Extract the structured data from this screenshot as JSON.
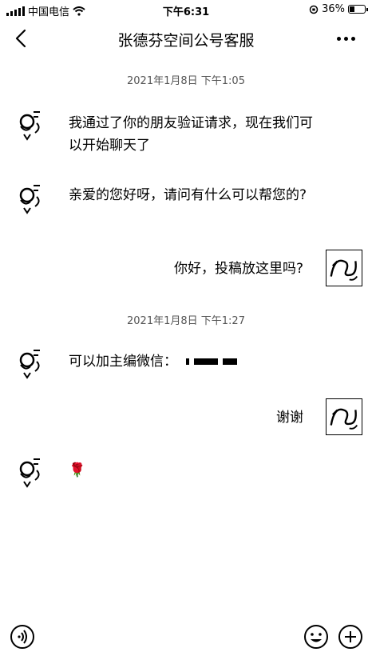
{
  "status_bar": {
    "carrier": "中国电信",
    "time": "下午6:31",
    "battery": "36%",
    "battery_level": 0.36
  },
  "header": {
    "title": "张德芬空间公号客服"
  },
  "chat": {
    "timestamp_1": "2021年1月8日 下午1:05",
    "timestamp_2": "2021年1月8日 下午1:27",
    "messages": [
      {
        "side": "left",
        "text": "我通过了你的朋友验证请求，现在我们可以开始聊天了"
      },
      {
        "side": "left",
        "text": "亲爱的您好呀，请问有什么可以帮您的?"
      },
      {
        "side": "right",
        "text": "你好，投稿放这里吗?"
      },
      {
        "side": "left",
        "text": "可以加主编微信："
      },
      {
        "side": "right",
        "text": "谢谢"
      },
      {
        "side": "left",
        "text": "🌹"
      }
    ]
  },
  "icons": {
    "back": "chevron-left-icon",
    "more": "more-icon",
    "voice": "voice-icon",
    "emoji": "emoji-icon",
    "plus": "plus-icon"
  }
}
